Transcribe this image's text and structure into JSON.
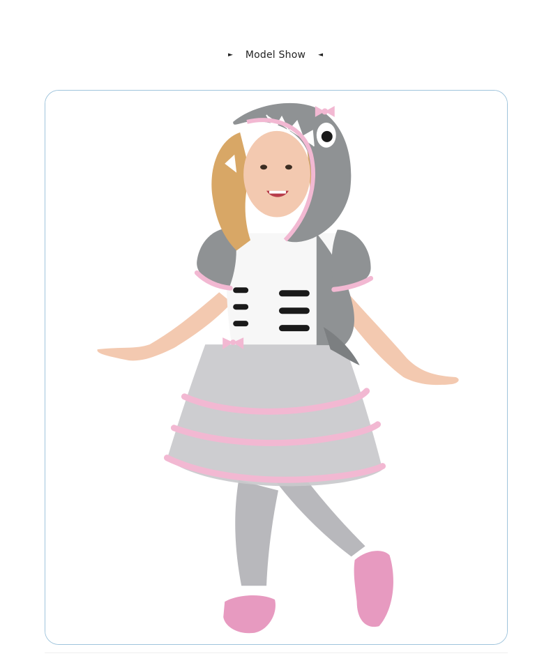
{
  "section": {
    "title": "Model Show",
    "left_arrow_icon": "triangle-right-icon",
    "right_arrow_icon": "triangle-left-icon"
  },
  "photo": {
    "subject": "child-model-photo",
    "frame_color": "#9fc4dc",
    "colors": {
      "costume_gray": "#8f9294",
      "trim_pink": "#f2b8d2",
      "bodice_white": "#f7f7f7",
      "tulle_gray": "#c9c9cc",
      "hair_blonde": "#d8a766",
      "skin": "#f3c9b0",
      "shoe_pink": "#e79ac0"
    }
  }
}
